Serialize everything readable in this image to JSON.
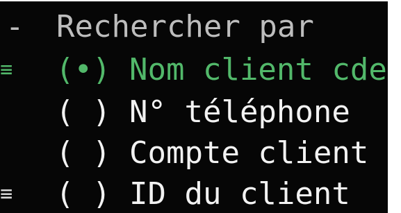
{
  "search_by": {
    "prefix": "-",
    "title": "Rechercher par",
    "options": [
      {
        "handle": "≡",
        "radio": "(•)",
        "label": "Nom client cde",
        "selected": true
      },
      {
        "handle": "",
        "radio": "( )",
        "label": "N° téléphone",
        "selected": false
      },
      {
        "handle": "",
        "radio": "( )",
        "label": "Compte client",
        "selected": false
      },
      {
        "handle": "≡",
        "radio": "( )",
        "label": "ID du client",
        "selected": false
      }
    ]
  },
  "colors": {
    "background": "#060606",
    "text": "#f2f2f2",
    "header_text": "#bdbdbd",
    "selected": "#52b86a"
  },
  "icons": {
    "handle": "drag-handle-icon",
    "radio_selected": "radio-selected-icon",
    "radio_unselected": "radio-unselected-icon"
  }
}
